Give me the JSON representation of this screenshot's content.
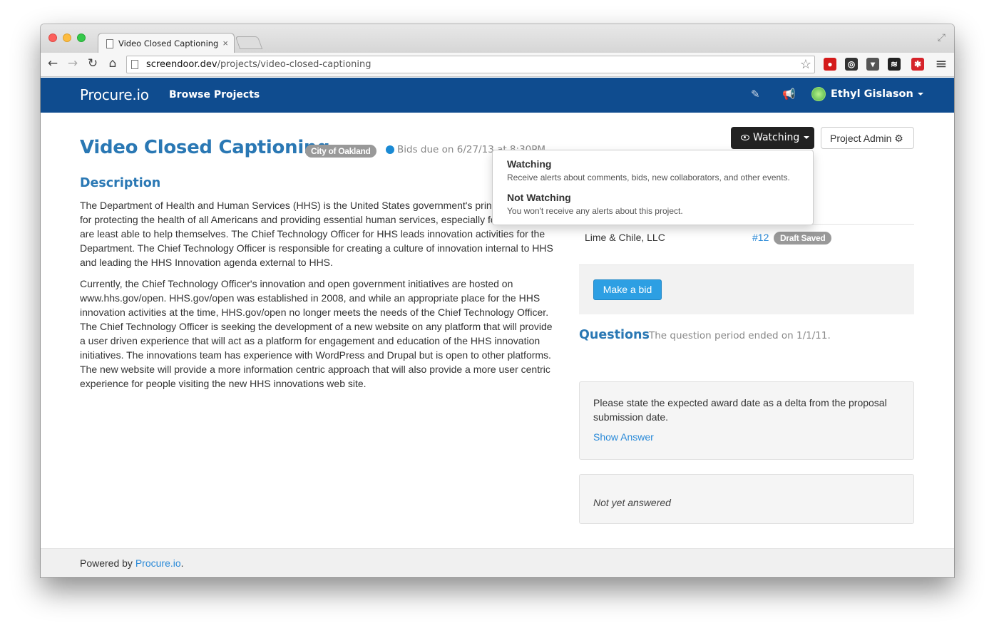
{
  "browser": {
    "tab_title": "Video Closed Captioning",
    "tab_close": "×",
    "url_host": "screendoor.dev",
    "url_path": "/projects/video-closed-captioning",
    "nav_back": "←",
    "nav_forward": "→",
    "nav_reload": "↻",
    "nav_home": "⌂",
    "star": "☆",
    "menu": "≡",
    "extensions": [
      {
        "name": "adblock-icon",
        "glyph": "●",
        "color": "#d41a1a"
      },
      {
        "name": "sync-icon",
        "glyph": "◎",
        "color": "#333333"
      },
      {
        "name": "pocket-icon",
        "glyph": "▾",
        "color": "#555555"
      },
      {
        "name": "buffer-icon",
        "glyph": "≋",
        "color": "#222222"
      },
      {
        "name": "lastpass-icon",
        "glyph": "✱",
        "color": "#d6232a"
      }
    ]
  },
  "navbar": {
    "brand": "Procure.io",
    "browse": "Browse Projects",
    "user_name": "Ethyl Gislason",
    "icons": [
      "edit-icon",
      "bullhorn-icon"
    ]
  },
  "project": {
    "title": "Video Closed Captioning",
    "org": "City of Oakland",
    "bids_due": "Bids due on 6/27/13 at 8:30PM"
  },
  "description": {
    "heading": "Description",
    "para1": "The Department of Health and Human Services (HHS) is the United States government's principal agency for protecting the health of all Americans and providing essential human services, especially for those who are least able to help themselves. The Chief Technology Officer for HHS leads innovation activities for the Department. The Chief Technology Officer is responsible for creating a culture of innovation internal to HHS and leading the HHS Innovation agenda external to HHS.",
    "para2": "Currently, the Chief Technology Officer's innovation and open government initiatives are hosted on www.hhs.gov/open. HHS.gov/open was established in 2008, and while an appropriate place for the HHS innovation activities at the time, HHS.gov/open no longer meets the needs of the Chief Technology Officer. The Chief Technology Officer is seeking the development of a new website on any platform that will provide a user driven experience that will act as a platform for engagement and education of the HHS innovation initiatives. The innovations team has experience with WordPress and Drupal but is open to other platforms. The new website will provide a more information centric approach that will also provide a more user centric experience for people visiting the new HHS innovations web site."
  },
  "actions": {
    "watch_label": "Watching",
    "admin_label": "Project Admin"
  },
  "watch_menu": [
    {
      "title": "Watching",
      "desc": "Receive alerts about comments, bids, new collaborators, and other events."
    },
    {
      "title": "Not Watching",
      "desc": "You won't receive any alerts about this project."
    }
  ],
  "bids": {
    "bidder": "Lime & Chile, LLC",
    "bid_number": "#12",
    "bid_status": "Draft Saved",
    "make_bid": "Make a bid"
  },
  "questions": {
    "heading": "Questions",
    "note": "The question period ended on 1/1/11.",
    "items": [
      {
        "text": "Please state the expected award date as a delta from the proposal submission date.",
        "action": "Show Answer"
      },
      {
        "text": "Not yet answered"
      }
    ]
  },
  "footer": {
    "prefix": "Powered by ",
    "link": "Procure.io",
    "suffix": "."
  }
}
